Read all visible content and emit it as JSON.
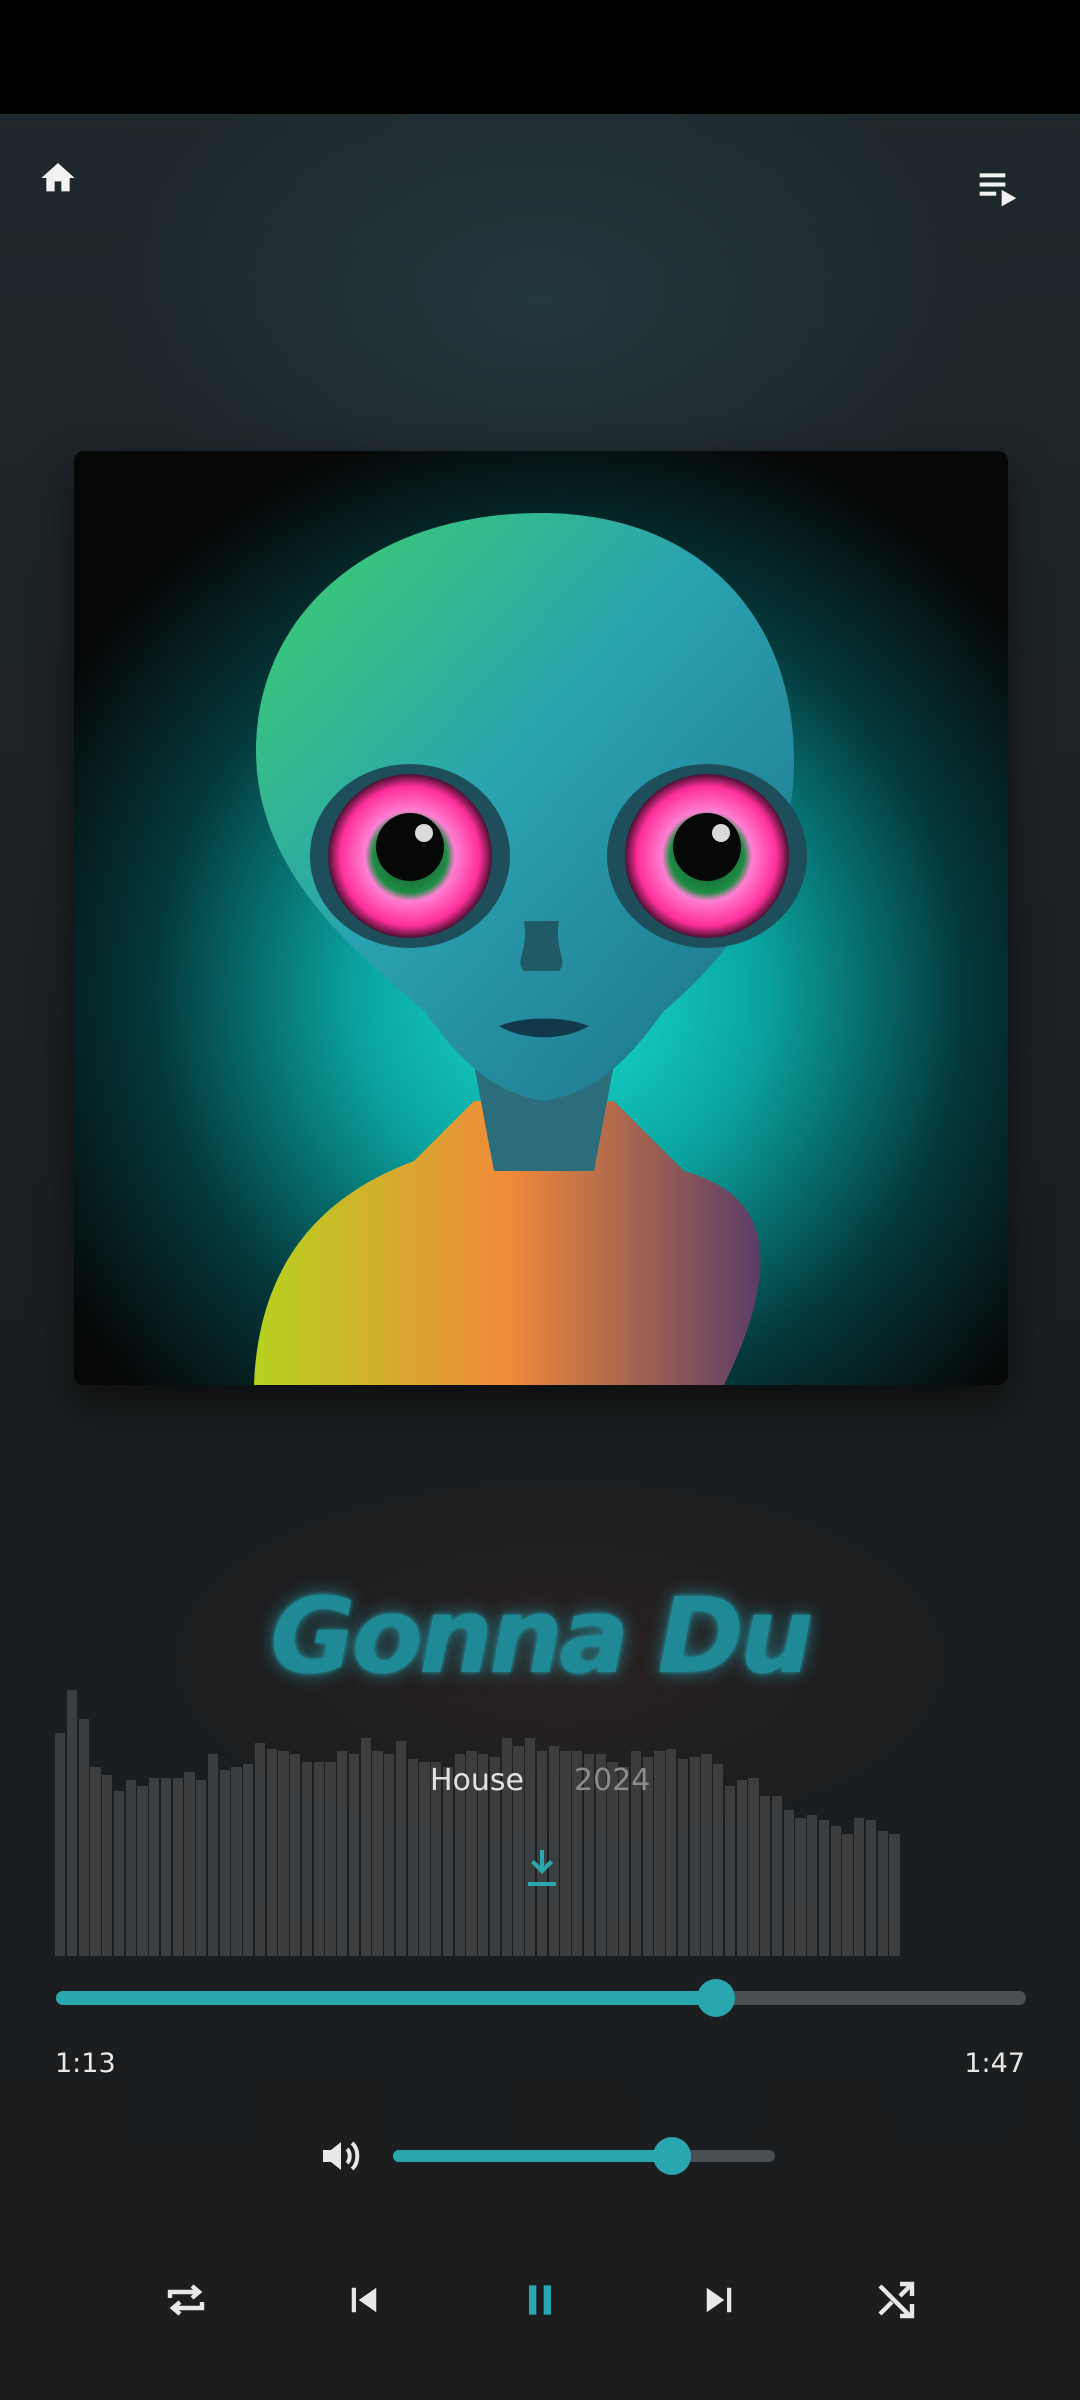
{
  "track": {
    "title": "Gonna Du",
    "genre": "House",
    "year": "2024",
    "elapsed": "1:13",
    "duration": "1:47",
    "progress_fraction": 0.68
  },
  "volume": {
    "level_fraction": 0.73
  },
  "playback": {
    "state": "playing"
  },
  "colors": {
    "accent": "#2aa6ae",
    "title_glow": "#1f8a96",
    "track": "#4a4f54",
    "background": "#1c1f21"
  },
  "icons": {
    "home": "home-icon",
    "queue": "queue-music-icon",
    "download": "download-icon",
    "volume": "volume-up-icon",
    "repeat": "repeat-icon",
    "previous": "skip-previous-icon",
    "pause": "pause-icon",
    "next": "skip-next-icon",
    "shuffle": "shuffle-icon"
  },
  "visualizer": {
    "levels": [
      0.84,
      1.0,
      0.89,
      0.71,
      0.68,
      0.62,
      0.66,
      0.64,
      0.67,
      0.67,
      0.67,
      0.69,
      0.66,
      0.76,
      0.7,
      0.71,
      0.72,
      0.8,
      0.78,
      0.77,
      0.76,
      0.73,
      0.73,
      0.73,
      0.77,
      0.76,
      0.82,
      0.77,
      0.76,
      0.81,
      0.74,
      0.73,
      0.73,
      0.71,
      0.76,
      0.77,
      0.76,
      0.75,
      0.82,
      0.79,
      0.82,
      0.77,
      0.79,
      0.77,
      0.77,
      0.76,
      0.76,
      0.73,
      0.71,
      0.77,
      0.75,
      0.77,
      0.78,
      0.74,
      0.75,
      0.76,
      0.72,
      0.64,
      0.66,
      0.67,
      0.6,
      0.6,
      0.55,
      0.52,
      0.53,
      0.51,
      0.49,
      0.46,
      0.52,
      0.51,
      0.47,
      0.46,
      0.47,
      0.44,
      0.41,
      0.37,
      0.41,
      0.43,
      0.39,
      0.37,
      0.36,
      0.38,
      0.35,
      0.32,
      0.3,
      0.24,
      0.27,
      0.28,
      0.3,
      0.26,
      0.25,
      0.23,
      0.21,
      0.21,
      0.2,
      0.18,
      0.18,
      0.16,
      0.15,
      0.15,
      0.15,
      0.16,
      0.13,
      0.13,
      0.1,
      0.1,
      0.08,
      0.08
    ]
  }
}
